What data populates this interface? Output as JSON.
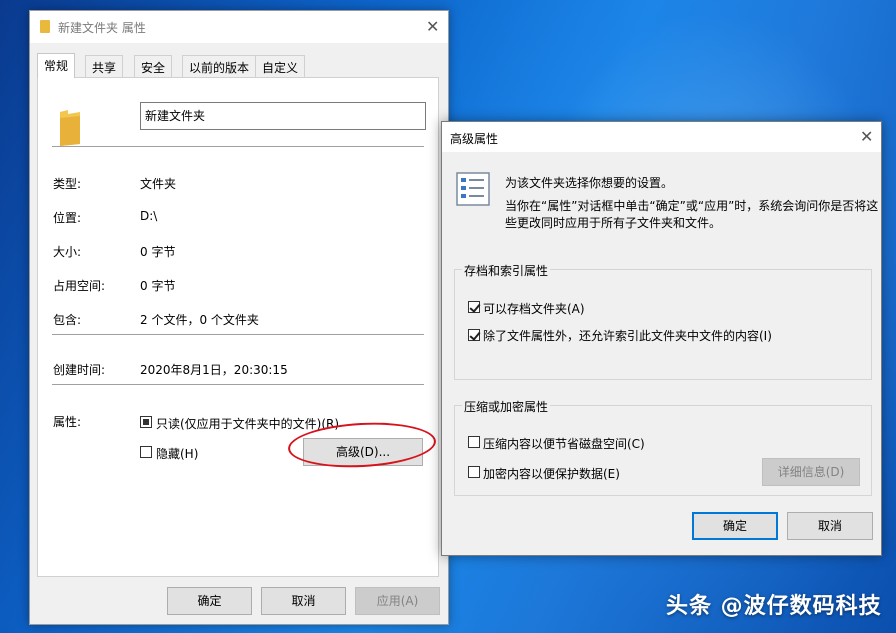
{
  "properties_window": {
    "title": "新建文件夹 属性",
    "close_glyph": "✕",
    "tabs": [
      "常规",
      "共享",
      "安全",
      "以前的版本",
      "自定义"
    ],
    "folder_name": "新建文件夹",
    "info": {
      "type_label": "类型:",
      "type_value": "文件夹",
      "location_label": "位置:",
      "location_value": "D:\\",
      "size_label": "大小:",
      "size_value": "0 字节",
      "size_on_disk_label": "占用空间:",
      "size_on_disk_value": "0 字节",
      "contains_label": "包含:",
      "contains_value": "2 个文件，0 个文件夹",
      "created_label": "创建时间:",
      "created_value": "2020年8月1日，20:30:15",
      "attributes_label": "属性:"
    },
    "readonly_label": "只读(仅应用于文件夹中的文件)(R)",
    "hidden_label": "隐藏(H)",
    "advanced_button": "高级(D)...",
    "ok_button": "确定",
    "cancel_button": "取消",
    "apply_button": "应用(A)"
  },
  "advanced_window": {
    "title": "高级属性",
    "close_glyph": "✕",
    "desc_line1": "为该文件夹选择你想要的设置。",
    "desc_line2": "当你在“属性”对话框中单击“确定”或“应用”时，系统会询问你是否将这",
    "desc_line3": "些更改同时应用于所有子文件夹和文件。",
    "archive_group_title": "存档和索引属性",
    "archive_label": "可以存档文件夹(A)",
    "archive_checked": true,
    "index_label": "除了文件属性外，还允许索引此文件夹中文件的内容(I)",
    "index_checked": true,
    "compress_group_title": "压缩或加密属性",
    "compress_label": "压缩内容以便节省磁盘空间(C)",
    "compress_checked": false,
    "encrypt_label": "加密内容以便保护数据(E)",
    "encrypt_checked": false,
    "details_button": "详细信息(D)",
    "ok_button": "确定",
    "cancel_button": "取消"
  },
  "watermark": "头条 @波仔数码科技",
  "colors": {
    "accent": "#0078d7",
    "annotation": "#d8121b",
    "folder": "#e8b93c"
  }
}
